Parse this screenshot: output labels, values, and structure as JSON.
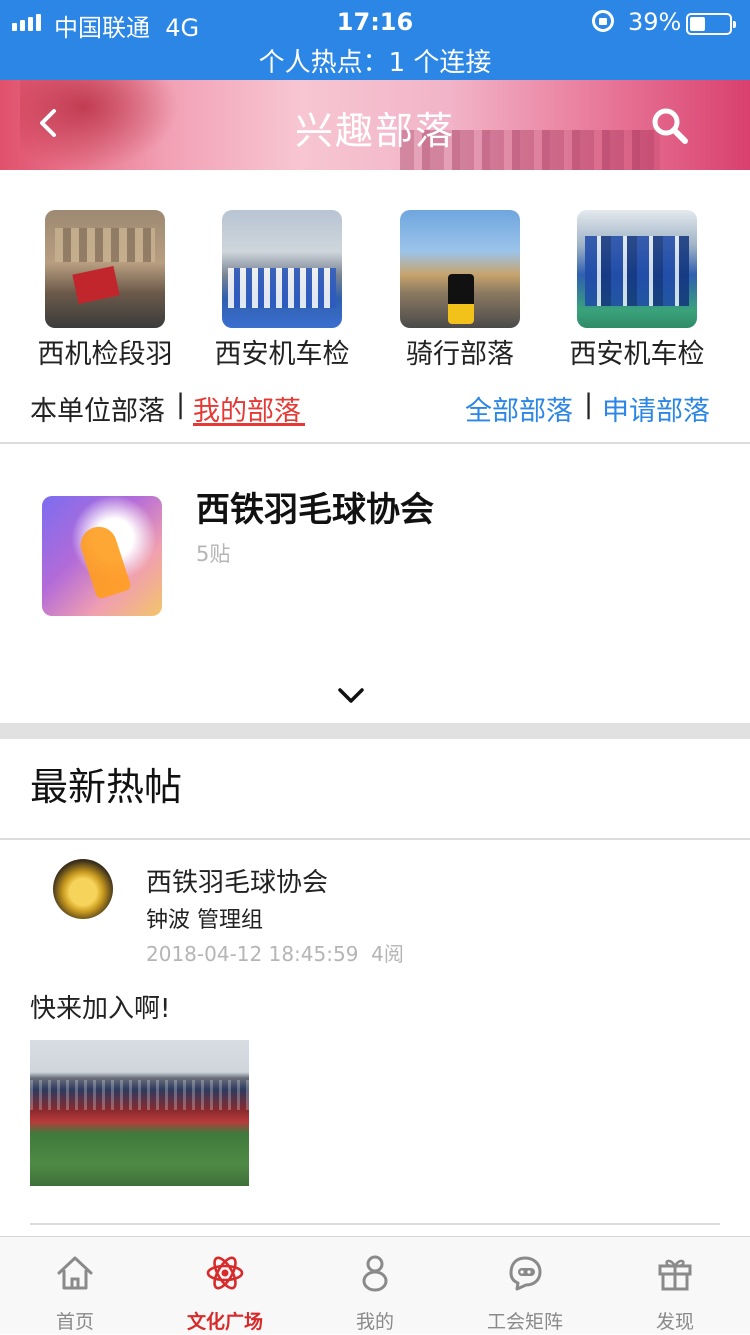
{
  "status_bar": {
    "carrier": "中国联通",
    "network": "4G",
    "time": "17:16",
    "battery": "39%",
    "battery_level": 0.39,
    "hotspot": "个人热点：1 个连接"
  },
  "header": {
    "title": "兴趣部落",
    "back_icon": "back-arrow-icon",
    "search_icon": "search-icon"
  },
  "featured_tribes": [
    {
      "name": "西机检段羽"
    },
    {
      "name": "西安机车检"
    },
    {
      "name": "骑行部落"
    },
    {
      "name": "西安机车检"
    }
  ],
  "tabs": {
    "unit": "本单位部落",
    "separator": "|",
    "mine": "我的部落",
    "all": "全部部落",
    "apply": "申请部落"
  },
  "my_tribe": {
    "name": "西铁羽毛球协会",
    "posts": "5贴"
  },
  "hot_posts": {
    "title": "最新热帖",
    "items": [
      {
        "group": "西铁羽毛球协会",
        "author": "钟波 管理组",
        "timestamp": "2018-04-12 18:45:59",
        "reads": "4阅",
        "text": "快来加入啊!"
      }
    ]
  },
  "bottom_nav": [
    {
      "label": "首页",
      "icon": "home-icon",
      "active": false
    },
    {
      "label": "文化广场",
      "icon": "atom-icon",
      "active": true
    },
    {
      "label": "我的",
      "icon": "person-icon",
      "active": false
    },
    {
      "label": "工会矩阵",
      "icon": "chat-robot-icon",
      "active": false
    },
    {
      "label": "发现",
      "icon": "gift-icon",
      "active": false
    }
  ],
  "colors": {
    "status_bar": "#2b86e6",
    "active_red": "#e53935",
    "link_blue": "#2b86e6",
    "muted_gray": "#b5b5b5"
  }
}
